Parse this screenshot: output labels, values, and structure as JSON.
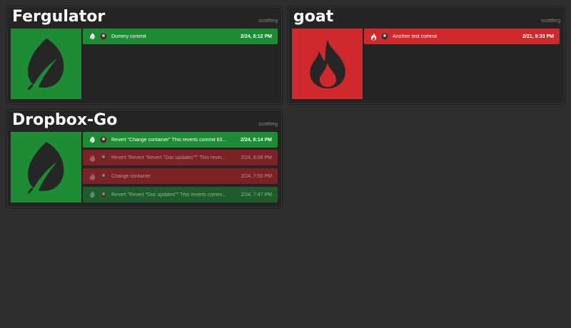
{
  "projects": [
    {
      "name": "Fergulator",
      "owner": "scottferg",
      "icon": "leaf-icon",
      "status_color": "#1e8c35",
      "commits": [
        {
          "message": "Dummy commit",
          "time": "2/24, 8:12 PM",
          "status": "success"
        }
      ]
    },
    {
      "name": "goat",
      "owner": "scottferg",
      "icon": "fire-icon",
      "status_color": "#d0292d",
      "commits": [
        {
          "message": "Another test commit",
          "time": "2/21, 9:33 PM",
          "status": "failure"
        }
      ]
    },
    {
      "name": "Dropbox-Go",
      "owner": "scottferg",
      "icon": "leaf-icon",
      "status_color": "#1e8c35",
      "commits": [
        {
          "message": "Revert \"Change container\" This reverts commit 63...",
          "time": "2/24, 8:14 PM",
          "status": "success"
        },
        {
          "message": "Revert \"Revert \"Revert \"Doc updates\"\"\" This rever...",
          "time": "2/24, 8:09 PM",
          "status": "failure"
        },
        {
          "message": "Change container",
          "time": "2/24, 7:50 PM",
          "status": "failure"
        },
        {
          "message": "Revert \"Revert \"Doc updates\"\" This reverts commi...",
          "time": "2/24, 7:47 PM",
          "status": "success"
        }
      ]
    }
  ],
  "colors": {
    "background": "#2e2e2e",
    "card": "#242424",
    "success": "#1e8c35",
    "failure": "#d0292d",
    "success_faded": "#1f5c2d",
    "failure_faded": "#7a2225"
  }
}
